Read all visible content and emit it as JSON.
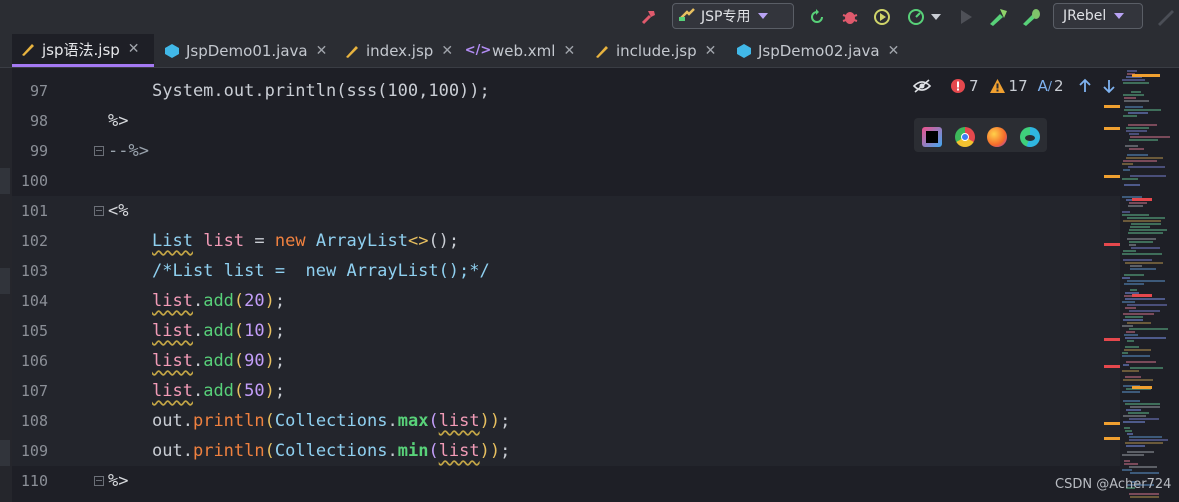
{
  "toolbar": {
    "run_config": "JSP专用",
    "jrebel": "JRebel",
    "icons": [
      "build-hammer-icon",
      "config-run-icon",
      "reload-icon",
      "debug-icon",
      "coverage-icon",
      "profiler-icon",
      "stop-icon",
      "jrebel-run-icon",
      "jrebel-debug-icon",
      "search-icon"
    ]
  },
  "tabs": [
    {
      "label": "jsp语法.jsp",
      "icon": "jsp-file-icon",
      "active": true
    },
    {
      "label": "JspDemo01.java",
      "icon": "java-class-icon",
      "active": false
    },
    {
      "label": "index.jsp",
      "icon": "jsp-file-icon",
      "active": false
    },
    {
      "label": "web.xml",
      "icon": "xml-file-icon",
      "active": false
    },
    {
      "label": "include.jsp",
      "icon": "jsp-file-icon",
      "active": false
    },
    {
      "label": "JspDemo02.java",
      "icon": "java-class-icon",
      "active": false
    }
  ],
  "lines": [
    "97",
    "98",
    "99",
    "100",
    "101",
    "102",
    "103",
    "104",
    "105",
    "106",
    "107",
    "108",
    "109",
    "110"
  ],
  "code": {
    "l97a": "System.",
    "l97b": "out.println(sss(100,100));",
    "l98": "%>",
    "l99": "--%>",
    "l101": "<%",
    "l102_type": "List",
    "l102_var": "list",
    "l102_eq": " = ",
    "l102_new": "new",
    "l102_cls": " ArrayList",
    "l102_gen": "<>",
    "l102_end": "();",
    "l103": "/*List list =  new ArrayList();*/",
    "add_calls": [
      {
        "var": "list",
        "dot": ".",
        "fn": "add",
        "open": "(",
        "num": "20",
        "close": ")",
        "semi": ";"
      },
      {
        "var": "list",
        "dot": ".",
        "fn": "add",
        "open": "(",
        "num": "10",
        "close": ")",
        "semi": ";"
      },
      {
        "var": "list",
        "dot": ".",
        "fn": "add",
        "open": "(",
        "num": "90",
        "close": ")",
        "semi": ";"
      },
      {
        "var": "list",
        "dot": ".",
        "fn": "add",
        "open": "(",
        "num": "50",
        "close": ")",
        "semi": ";"
      }
    ],
    "l108": {
      "obj": "out",
      "dot": ".",
      "fn": "println",
      "open": "(",
      "cls": "Collections",
      "dot2": ".",
      "m": "max",
      "open2": "(",
      "arg": "list",
      "close": "))",
      "semi": ";"
    },
    "l109": {
      "obj": "out",
      "dot": ".",
      "fn": "println",
      "open": "(",
      "cls": "Collections",
      "dot2": ".",
      "m": "min",
      "open2": "(",
      "arg": "list",
      "close": "))",
      "semi": ";"
    },
    "l110": "%>"
  },
  "inspections": {
    "errors": "7",
    "warnings": "17",
    "typos": "2"
  },
  "browsers": [
    "intellij-icon",
    "chrome-icon",
    "firefox-icon",
    "edge-icon"
  ],
  "watermark": "CSDN @Acher724"
}
